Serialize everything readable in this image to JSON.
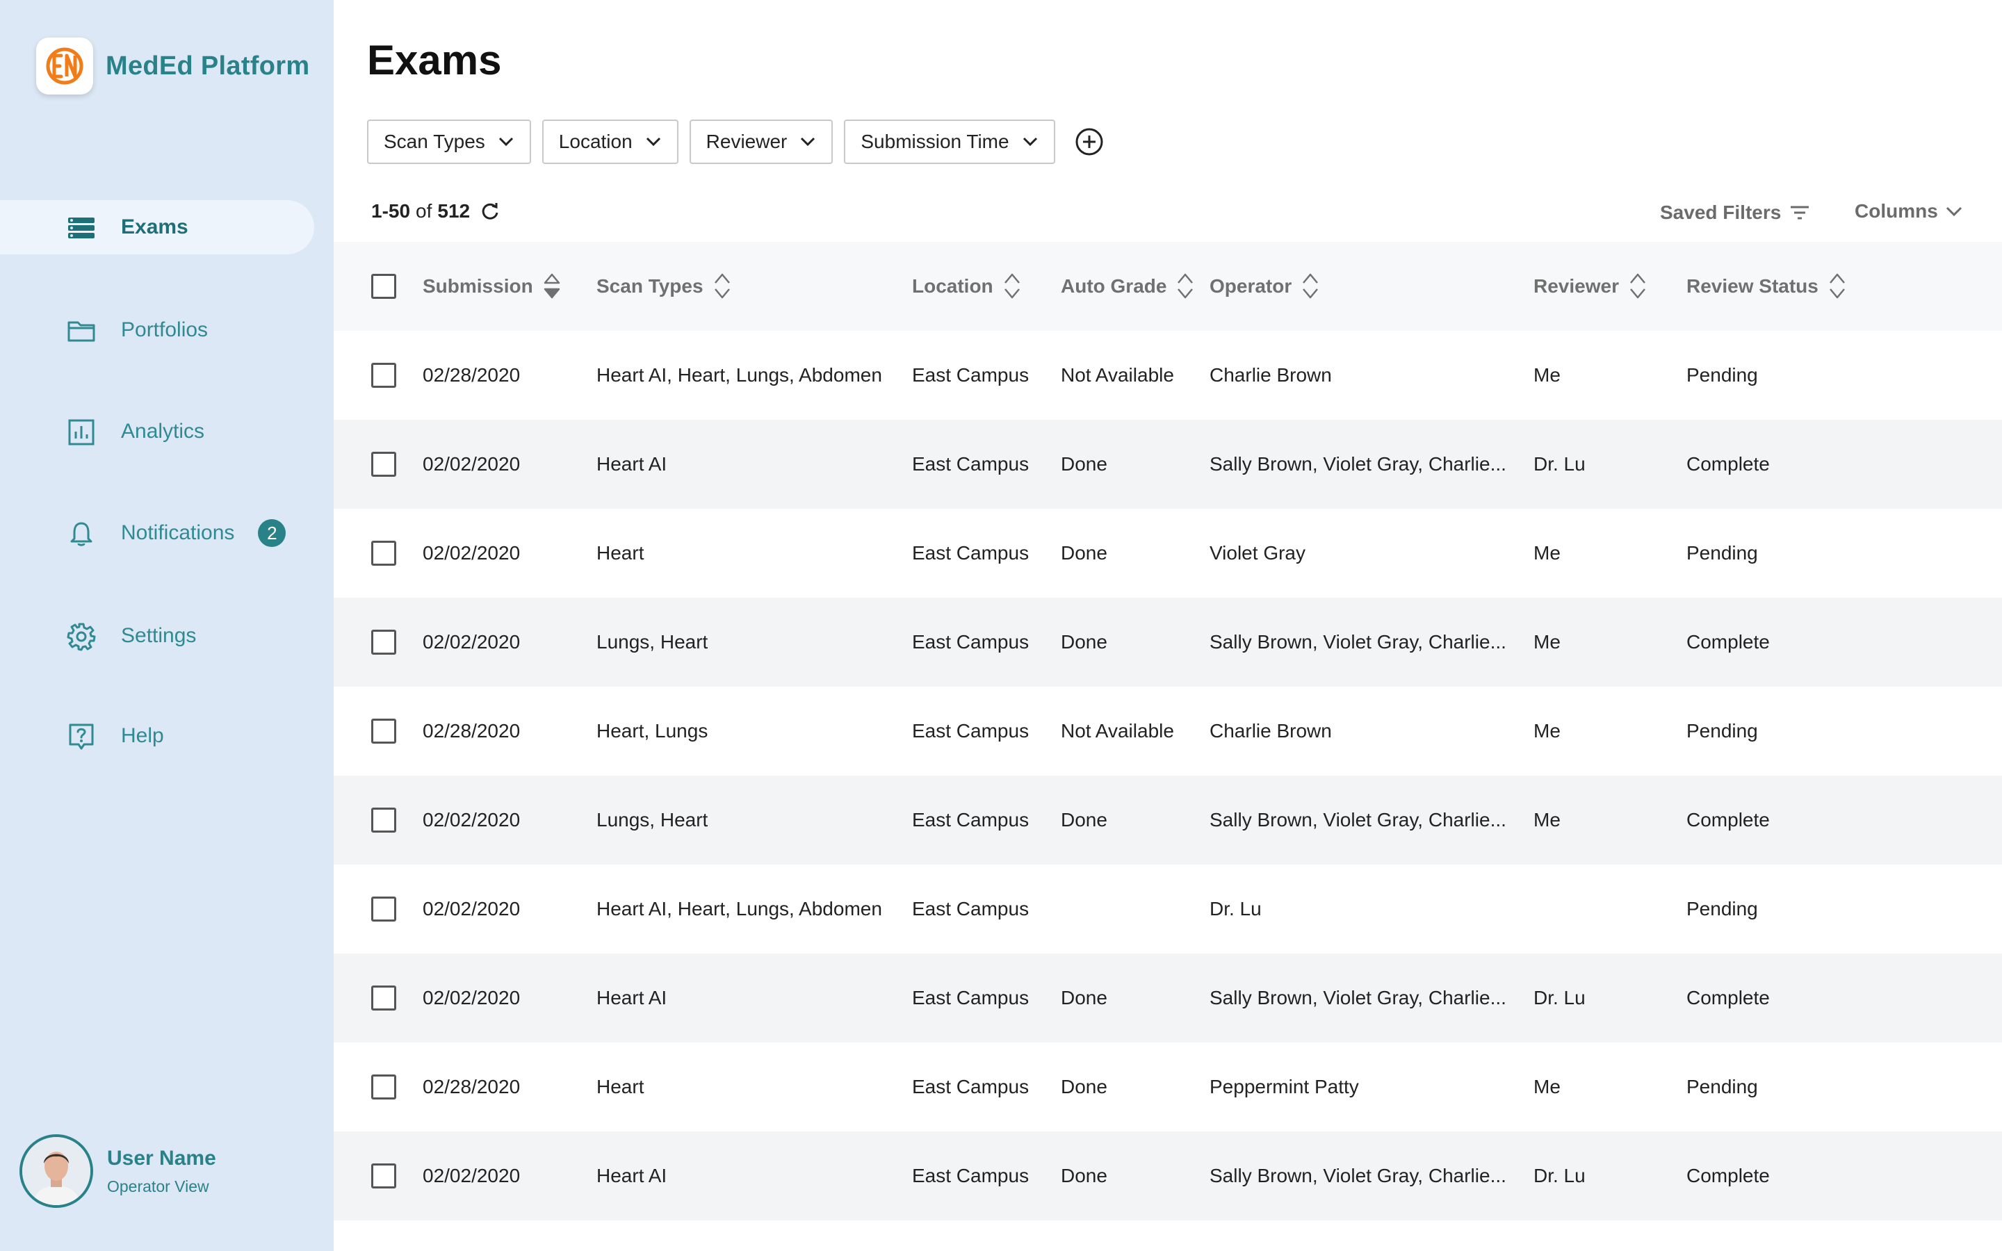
{
  "brand": {
    "name": "MedEd Platform"
  },
  "nav": {
    "items": [
      {
        "label": "Exams",
        "icon": "list-icon",
        "active": true
      },
      {
        "label": "Portfolios",
        "icon": "folder-icon"
      },
      {
        "label": "Analytics",
        "icon": "chart-icon"
      },
      {
        "label": "Notifications",
        "icon": "bell-icon",
        "badge": "2"
      },
      {
        "label": "Settings",
        "icon": "gear-icon"
      },
      {
        "label": "Help",
        "icon": "help-icon"
      }
    ]
  },
  "user": {
    "name": "User Name",
    "role": "Operator View"
  },
  "page": {
    "title": "Exams"
  },
  "filters": [
    {
      "label": "Scan Types"
    },
    {
      "label": "Location"
    },
    {
      "label": "Reviewer"
    },
    {
      "label": "Submission Time"
    }
  ],
  "pagination": {
    "range": "1-50",
    "of": "of",
    "total": "512"
  },
  "toolbar": {
    "saved_filters": "Saved Filters",
    "columns": "Columns"
  },
  "table": {
    "headers": {
      "submission": "Submission",
      "scan_types": "Scan Types",
      "location": "Location",
      "auto_grade": "Auto Grade",
      "operator": "Operator",
      "reviewer": "Reviewer",
      "review_status": "Review Status"
    },
    "rows": [
      [
        "02/28/2020",
        "Heart AI, Heart, Lungs, Abdomen",
        "East Campus",
        "Not Available",
        "Charlie Brown",
        "Me",
        "Pending"
      ],
      [
        "02/02/2020",
        "Heart AI",
        "East Campus",
        "Done",
        "Sally Brown, Violet Gray, Charlie...",
        "Dr. Lu",
        "Complete"
      ],
      [
        "02/02/2020",
        "Heart",
        "East Campus",
        "Done",
        "Violet Gray",
        "Me",
        "Pending"
      ],
      [
        "02/02/2020",
        "Lungs, Heart",
        "East Campus",
        "Done",
        "Sally Brown, Violet Gray, Charlie...",
        "Me",
        "Complete"
      ],
      [
        "02/28/2020",
        "Heart, Lungs",
        "East Campus",
        "Not Available",
        "Charlie Brown",
        "Me",
        "Pending"
      ],
      [
        "02/02/2020",
        "Lungs, Heart",
        "East Campus",
        "Done",
        "Sally Brown, Violet Gray, Charlie...",
        "Me",
        "Complete"
      ],
      [
        "02/02/2020",
        "Heart AI, Heart, Lungs, Abdomen",
        "East Campus",
        "",
        "Dr. Lu",
        "",
        "Pending"
      ],
      [
        "02/02/2020",
        "Heart AI",
        "East Campus",
        "Done",
        "Sally Brown, Violet Gray, Charlie...",
        "Dr. Lu",
        "Complete"
      ],
      [
        "02/28/2020",
        "Heart",
        "East Campus",
        "Done",
        "Peppermint Patty",
        "Me",
        "Pending"
      ],
      [
        "02/02/2020",
        "Heart AI",
        "East Campus",
        "Done",
        "Sally Brown, Violet Gray, Charlie...",
        "Dr. Lu",
        "Complete"
      ]
    ]
  },
  "colors": {
    "accent": "#2a8289",
    "sidebar_bg": "#dce8f5",
    "logo_orange": "#f07d1a"
  }
}
